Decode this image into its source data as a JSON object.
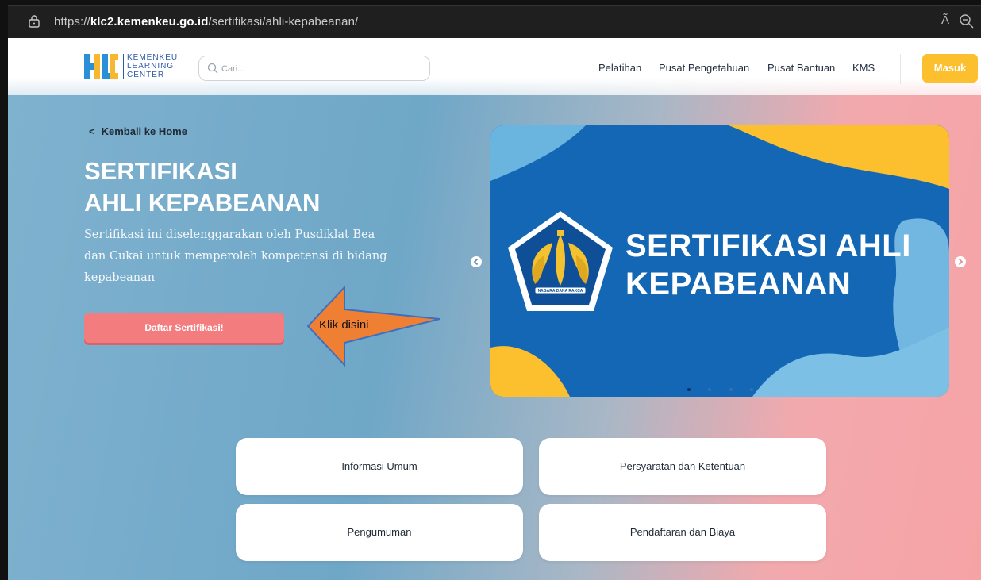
{
  "browser": {
    "url_prefix": "https://",
    "url_domain": "klc2.kemenkeu.go.id",
    "url_path": "/sertifikasi/ahli-kepabeanan/",
    "read_aloud": "Ã"
  },
  "header": {
    "logo_lines": [
      "KEMENKEU",
      "LEARNING",
      "CENTER"
    ],
    "search_placeholder": "Cari...",
    "nav": [
      "Pelatihan",
      "Pusat Pengetahuan",
      "Pusat Bantuan",
      "KMS"
    ],
    "login_label": "Masuk"
  },
  "hero": {
    "back_label": "Kembali ke Home",
    "title_line1": "SERTIFIKASI",
    "title_line2": "AHLI KEPABEANAN",
    "description": "Sertifikasi ini diselenggarakan oleh Pusdiklat Bea dan Cukai untuk memperoleh kompetensi di bidang kepabeanan",
    "cta_label": "Daftar Sertifikasi!",
    "annotation": "Klik disini"
  },
  "banner": {
    "title_line1": "SERTIFIKASI AHLI",
    "title_line2": "KEPABEANAN",
    "emblem_motto": "NAGARA DANA RAKCA",
    "slide_count": 4,
    "active_slide": 1
  },
  "cards": [
    "Informasi Umum",
    "Persyaratan dan Ketentuan",
    "Pengumuman",
    "Pendaftaran dan Biaya"
  ],
  "colors": {
    "accent_yellow": "#fcbf2e",
    "cta_red": "#f37c7f",
    "banner_blue": "#1367b4",
    "logo_blue": "#2b5aa5"
  }
}
